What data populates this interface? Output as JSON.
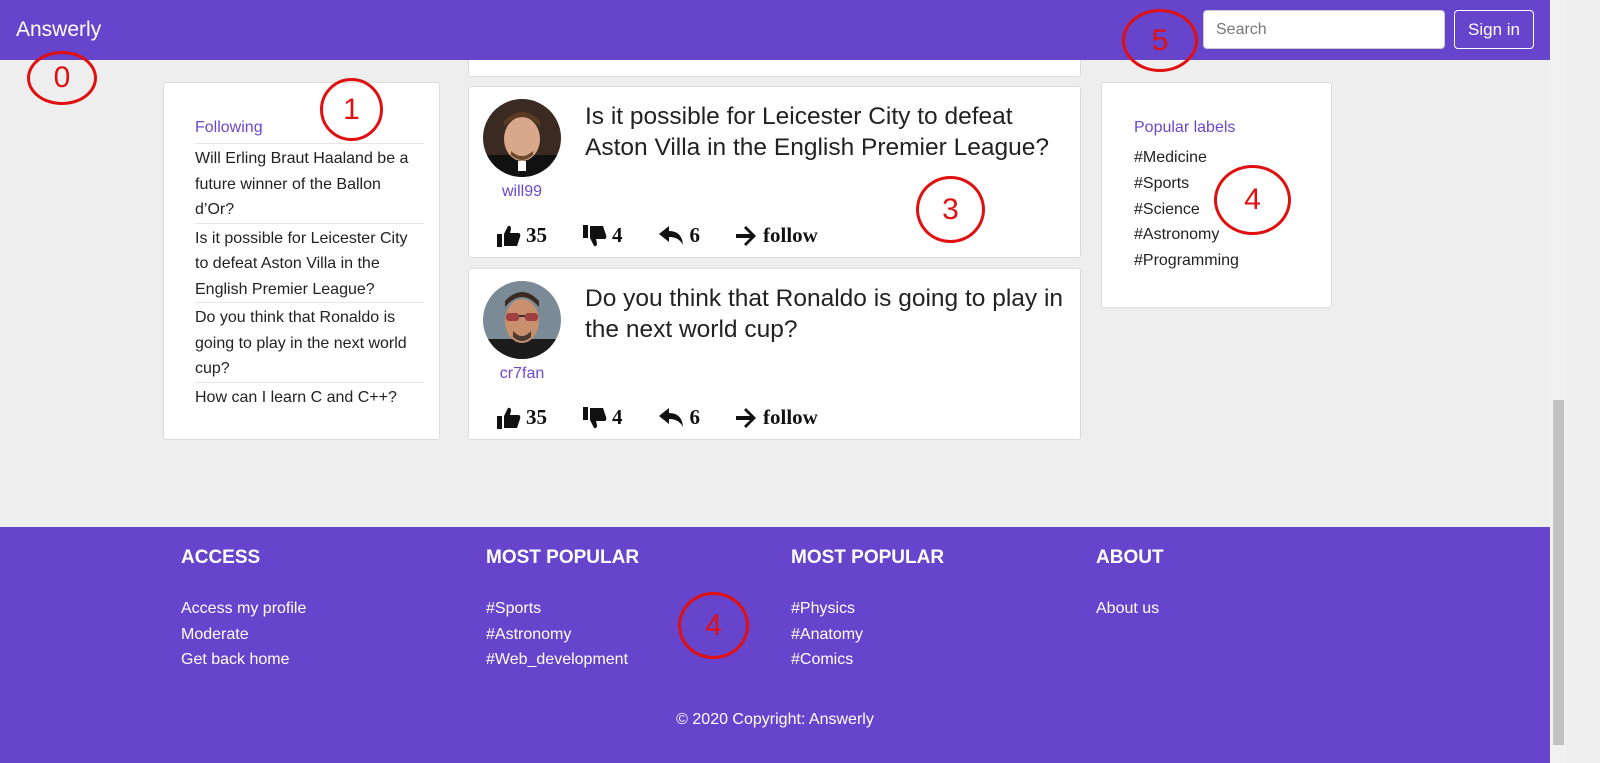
{
  "navbar": {
    "brand": "Answerly",
    "search_placeholder": "Search",
    "signin_label": "Sign in"
  },
  "left_panel": {
    "title": "Following",
    "items": [
      "Will Erling Braut Haaland be a future winner of the Ballon d’Or?",
      "Is it possible for Leicester City to defeat Aston Villa in the English Premier League?",
      "Do you think that Ronaldo is going to play in the next world cup?",
      "How can I learn C and C++?"
    ]
  },
  "right_panel": {
    "title": "Popular labels",
    "labels": [
      "#Medicine",
      "#Sports",
      "#Science",
      "#Astronomy",
      "#Programming"
    ]
  },
  "questions": [
    {
      "user": "will99",
      "text": "Is it possible for Leicester City to defeat Aston Villa in the English Premier League?",
      "likes": "35",
      "dislikes": "4",
      "replies": "6",
      "follow_label": "follow"
    },
    {
      "user": "cr7fan",
      "text": "Do you think that Ronaldo is going to play in the next world cup?",
      "likes": "35",
      "dislikes": "4",
      "replies": "6",
      "follow_label": "follow"
    }
  ],
  "footer": {
    "columns": [
      {
        "heading": "ACCESS",
        "links": [
          "Access my profile",
          "Moderate",
          "Get back home"
        ]
      },
      {
        "heading": "MOST POPULAR",
        "links": [
          "#Sports",
          "#Astronomy",
          "#Web_development"
        ]
      },
      {
        "heading": "MOST POPULAR",
        "links": [
          "#Physics",
          "#Anatomy",
          "#Comics"
        ]
      },
      {
        "heading": "ABOUT",
        "links": [
          "About us"
        ]
      }
    ],
    "copyright": "© 2020 Copyright: Answerly"
  },
  "annotations": [
    "0",
    "1",
    "3",
    "4",
    "4",
    "5"
  ],
  "colors": {
    "brand": "#6644cc",
    "annotation": "#e01010",
    "link": "#6a48cc"
  }
}
